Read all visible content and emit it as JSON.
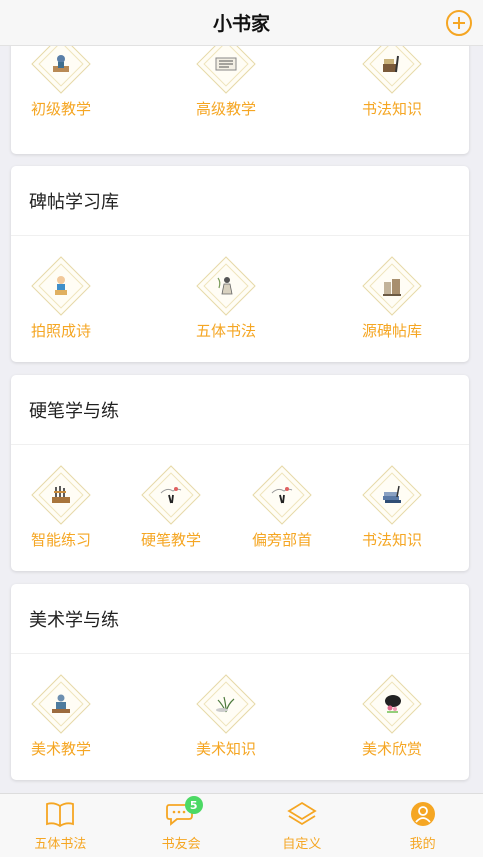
{
  "header": {
    "title": "小书家"
  },
  "sections": [
    {
      "title": "",
      "items": [
        {
          "label": "初级教学",
          "icon": "scholar-figure-icon"
        },
        {
          "label": "高级教学",
          "icon": "calligraphy-scroll-icon"
        },
        {
          "label": "书法知识",
          "icon": "brush-and-books-icon"
        }
      ]
    },
    {
      "title": "碑帖学习库",
      "items": [
        {
          "label": "拍照成诗",
          "icon": "child-reader-icon"
        },
        {
          "label": "五体书法",
          "icon": "ink-painting-figure-icon"
        },
        {
          "label": "源碑帖库",
          "icon": "stone-tablet-icon"
        }
      ]
    },
    {
      "title": "硬笔学与练",
      "items": [
        {
          "label": "智能练习",
          "icon": "brush-stand-icon"
        },
        {
          "label": "硬笔教学",
          "icon": "ink-landscape-icon"
        },
        {
          "label": "偏旁部首",
          "icon": "ink-landscape-icon"
        },
        {
          "label": "书法知识",
          "icon": "books-stack-icon"
        }
      ]
    },
    {
      "title": "美术学与练",
      "items": [
        {
          "label": "美术教学",
          "icon": "seated-scholar-icon"
        },
        {
          "label": "美术知识",
          "icon": "orchid-painting-icon"
        },
        {
          "label": "美术欣赏",
          "icon": "flower-fan-icon"
        }
      ]
    }
  ],
  "tabbar": {
    "items": [
      {
        "label": "五体书法",
        "icon": "book-open-icon"
      },
      {
        "label": "书友会",
        "icon": "chat-bubble-icon",
        "badge": "5"
      },
      {
        "label": "自定义",
        "icon": "layers-icon"
      },
      {
        "label": "我的",
        "icon": "user-circle-icon"
      }
    ]
  },
  "colors": {
    "accent": "#f5a623",
    "badge": "#4cd964",
    "background": "#efeff4"
  }
}
